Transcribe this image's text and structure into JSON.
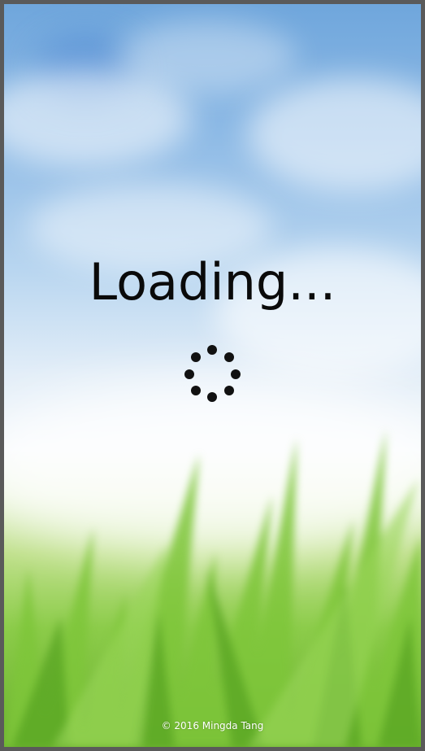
{
  "splash": {
    "loading_text": "Loading...",
    "spinner_icon": "loading-spinner-icon",
    "spinner_dot_count": 8,
    "footer_text": "© 2016 Mingda Tang"
  },
  "colors": {
    "text": "#0a0a0a",
    "spinner": "#111111",
    "footer": "#ffffff",
    "sky": "#8fbbe6",
    "grass": "#6cb22f"
  }
}
